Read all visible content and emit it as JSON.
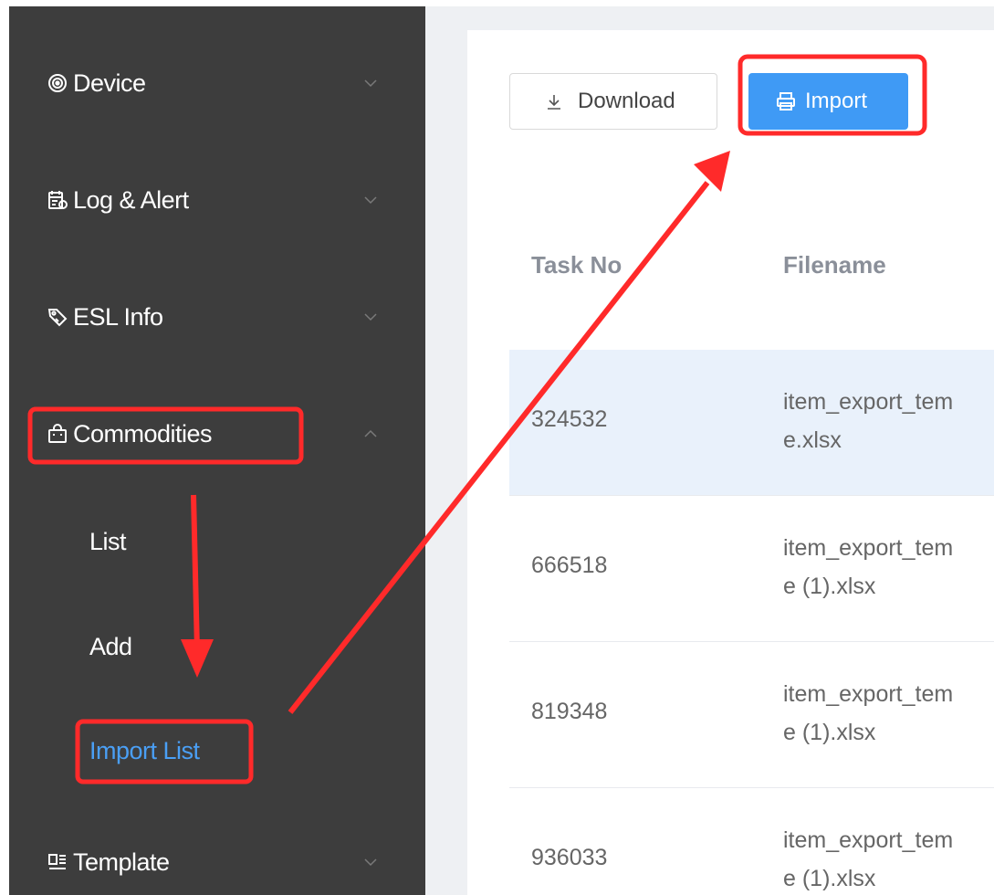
{
  "sidebar": {
    "items": [
      {
        "label": "Device",
        "icon": "signal-icon",
        "expanded": false
      },
      {
        "label": "Log & Alert",
        "icon": "calendar-log-icon",
        "expanded": false
      },
      {
        "label": "ESL Info",
        "icon": "tag-icon",
        "expanded": false
      },
      {
        "label": "Commodities",
        "icon": "shopping-bag-icon",
        "expanded": true
      },
      {
        "label": "Template",
        "icon": "template-icon",
        "expanded": false
      }
    ],
    "subitems": [
      {
        "label": "List",
        "active": false
      },
      {
        "label": "Add",
        "active": false
      },
      {
        "label": "Import List",
        "active": true
      }
    ]
  },
  "toolbar": {
    "download_label": "Download",
    "import_label": "Import"
  },
  "table": {
    "headers": [
      "Task No",
      "Filename"
    ],
    "rows": [
      {
        "task": "324532",
        "file_line1": "item_export_tem",
        "file_line2": "e.xlsx"
      },
      {
        "task": "666518",
        "file_line1": "item_export_tem",
        "file_line2": "e (1).xlsx"
      },
      {
        "task": "819348",
        "file_line1": "item_export_tem",
        "file_line2": "e (1).xlsx"
      },
      {
        "task": "936033",
        "file_line1": "item_export_tem",
        "file_line2": "e (1).xlsx"
      }
    ]
  },
  "colors": {
    "sidebar_bg": "#3d3d3d",
    "accent": "#3f9af5",
    "active_text": "#4a9ff5",
    "annotation": "#ff2a2a",
    "row_highlight": "#e9f1fb"
  }
}
